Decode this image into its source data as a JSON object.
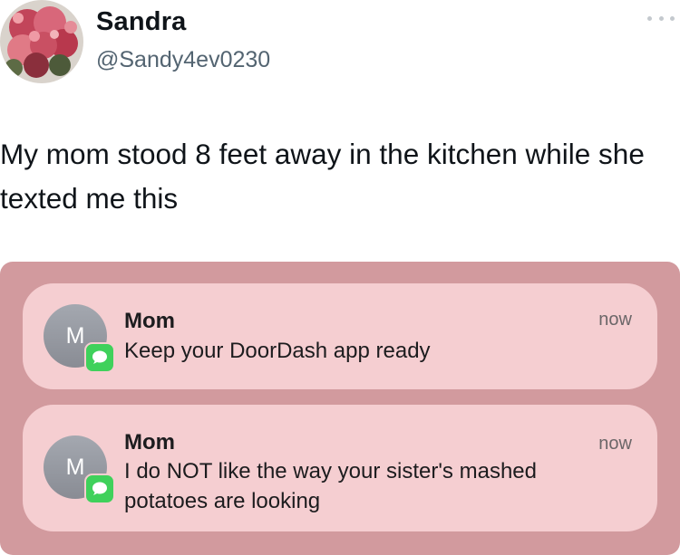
{
  "tweet": {
    "author": {
      "display_name": "Sandra",
      "handle": "@Sandy4ev0230",
      "avatar_icon": "flower-bouquet-avatar"
    },
    "more_icon": "more-dots-icon",
    "text": "My mom stood 8 feet away in the kitchen while she texted me this"
  },
  "notifications": [
    {
      "avatar_initial": "M",
      "app_badge_icon": "messages-app-icon",
      "sender": "Mom",
      "message": "Keep your DoorDash app ready",
      "time": "now"
    },
    {
      "avatar_initial": "M",
      "app_badge_icon": "messages-app-icon",
      "sender": "Mom",
      "message": "I do NOT like the way your sister's mashed potatoes are looking",
      "time": "now"
    }
  ],
  "colors": {
    "embed_background": "#d29a9e",
    "notification_background": "#f5ced1",
    "messages_green": "#3fd15b",
    "handle_gray": "#536471"
  }
}
